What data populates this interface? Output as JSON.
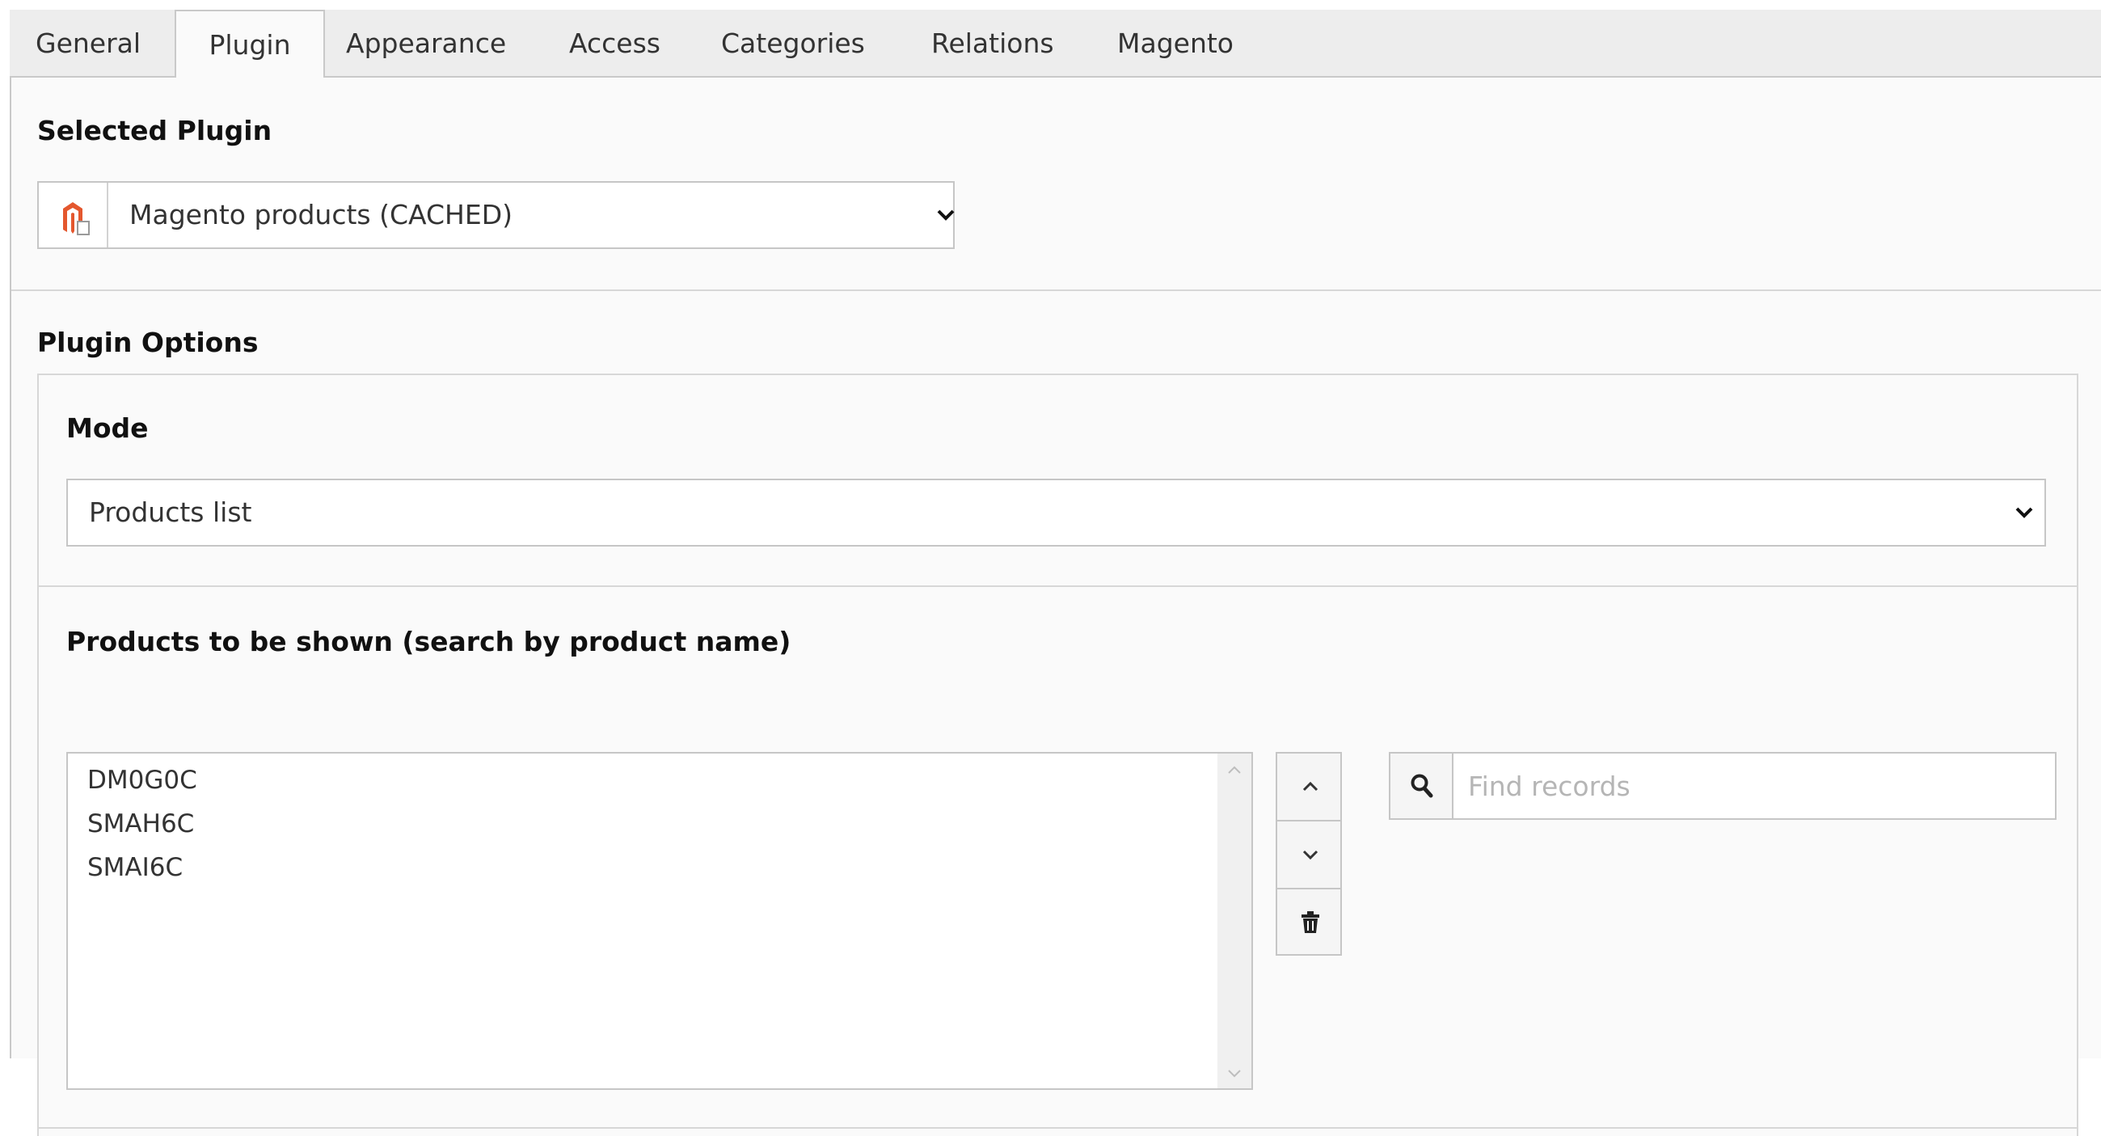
{
  "tabs": [
    {
      "label": "General"
    },
    {
      "label": "Plugin"
    },
    {
      "label": "Appearance"
    },
    {
      "label": "Access"
    },
    {
      "label": "Categories"
    },
    {
      "label": "Relations"
    },
    {
      "label": "Magento"
    }
  ],
  "active_tab": "Plugin",
  "selected_plugin": {
    "label": "Selected Plugin",
    "value": "Magento products (CACHED)",
    "icon": "magento-icon"
  },
  "plugin_options": {
    "label": "Plugin Options",
    "mode": {
      "label": "Mode",
      "value": "Products list"
    },
    "products": {
      "label": "Products to be shown (search by product name)",
      "items": [
        "DM0G0C",
        "SMAH6C",
        "SMAI6C"
      ],
      "search_placeholder": "Find records"
    }
  },
  "colors": {
    "magento_orange": "#e4572e",
    "border": "#c6c6c6",
    "tab_bar": "#ededed"
  }
}
